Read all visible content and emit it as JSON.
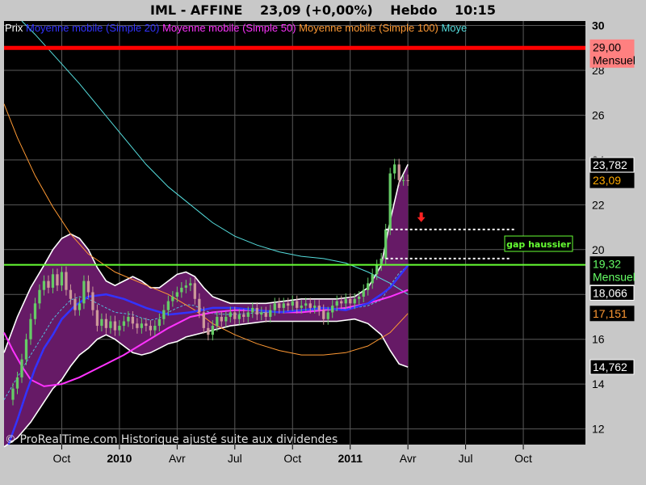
{
  "title": {
    "symbol": "IML - AFFINE",
    "price": "23,09 (+0,00%)",
    "period": "Hebdo",
    "time": "10:15"
  },
  "legend": [
    {
      "label": "Prix",
      "color": "#ffffff"
    },
    {
      "label": "Moyenne mobile (Simple 20)",
      "color": "#3333ff"
    },
    {
      "label": "Moyenne mobile (Simple 50)",
      "color": "#ff33ff"
    },
    {
      "label": "Moyenne mobile (Simple 100)",
      "color": "#ff9933"
    },
    {
      "label": "Moye",
      "color": "#55dddd"
    }
  ],
  "watermark": "© ProRealTime.com Historique ajusté suite aux dividendes",
  "price_tags": [
    {
      "text": "29,00",
      "sub": "Mensuel",
      "value": 29.0,
      "bg": "#ff8080",
      "fg": "#000000"
    },
    {
      "text": "23,782",
      "value": 23.782,
      "bg": "#000000",
      "fg": "#ffffff"
    },
    {
      "text": "23,09",
      "value": 23.09,
      "bg": "#000000",
      "fg": "#ffaa00"
    },
    {
      "text": "19,32",
      "sub": "Mensuel",
      "value": 19.32,
      "bg": "#000000",
      "fg": "#66ff66"
    },
    {
      "text": "18,066",
      "value": 18.066,
      "bg": "#000000",
      "fg": "#ffffff"
    },
    {
      "text": "17,151",
      "value": 17.151,
      "bg": "#000000",
      "fg": "#ff9933"
    },
    {
      "text": "14,762",
      "value": 14.762,
      "bg": "#000000",
      "fg": "#ffffff"
    }
  ],
  "chart_data": {
    "type": "candlestick",
    "y_ticks": [
      12,
      14,
      16,
      18,
      20,
      22,
      24,
      26,
      28,
      30
    ],
    "y_tick_labels": [
      "12",
      "14",
      "16",
      "18",
      "20",
      "22",
      "24",
      "26",
      "28",
      "30"
    ],
    "ylim": [
      11.3,
      30.2
    ],
    "x_ticks": [
      {
        "label": "Oct",
        "week": 6,
        "bold": false
      },
      {
        "label": "2010",
        "week": 19,
        "bold": true
      },
      {
        "label": "Avr",
        "week": 32,
        "bold": false
      },
      {
        "label": "Jul",
        "week": 45,
        "bold": false
      },
      {
        "label": "Oct",
        "week": 58,
        "bold": false
      },
      {
        "label": "2011",
        "week": 71,
        "bold": true
      },
      {
        "label": "Avr",
        "week": 84,
        "bold": false
      },
      {
        "label": "Jul",
        "week": 97,
        "bold": false
      },
      {
        "label": "Oct",
        "week": 110,
        "bold": false
      }
    ],
    "x_range_weeks": [
      -7,
      124
    ],
    "last_week": 84,
    "horizontal_lines": [
      {
        "value": 29.0,
        "color": "#ff0000",
        "label": "Mensuel"
      },
      {
        "value": 19.32,
        "color": "#66ff33",
        "label": "Mensuel"
      }
    ],
    "gap": {
      "upper": 20.9,
      "lower": 19.6,
      "from_week": 79,
      "to_week": 108,
      "label": "gap haussier",
      "arrow_week": 87,
      "arrow_value": 21.3
    },
    "closes_by_week": [
      [
        -6,
        13.3
      ],
      [
        -5,
        13.8
      ],
      [
        -4,
        14.3
      ],
      [
        -3,
        15.1
      ],
      [
        -2,
        16.0
      ],
      [
        -1,
        16.9
      ],
      [
        0,
        17.6
      ],
      [
        1,
        18.2
      ],
      [
        2,
        18.6
      ],
      [
        3,
        18.3
      ],
      [
        4,
        18.9
      ],
      [
        5,
        18.4
      ],
      [
        6,
        19.0
      ],
      [
        7,
        18.2
      ],
      [
        8,
        17.8
      ],
      [
        9,
        17.3
      ],
      [
        10,
        17.6
      ],
      [
        11,
        18.6
      ],
      [
        12,
        18.1
      ],
      [
        13,
        17.3
      ],
      [
        14,
        16.6
      ],
      [
        15,
        16.9
      ],
      [
        16,
        16.5
      ],
      [
        17,
        16.8
      ],
      [
        18,
        16.4
      ],
      [
        19,
        16.6
      ],
      [
        20,
        16.8
      ],
      [
        21,
        17.0
      ],
      [
        22,
        16.7
      ],
      [
        23,
        16.5
      ],
      [
        24,
        16.7
      ],
      [
        25,
        16.6
      ],
      [
        26,
        16.4
      ],
      [
        27,
        16.6
      ],
      [
        28,
        16.9
      ],
      [
        29,
        17.3
      ],
      [
        30,
        17.7
      ],
      [
        31,
        17.9
      ],
      [
        32,
        18.1
      ],
      [
        33,
        18.3
      ],
      [
        34,
        18.4
      ],
      [
        35,
        18.5
      ],
      [
        36,
        17.8
      ],
      [
        37,
        17.2
      ],
      [
        38,
        16.5
      ],
      [
        39,
        16.2
      ],
      [
        40,
        16.6
      ],
      [
        41,
        17.0
      ],
      [
        42,
        16.8
      ],
      [
        43,
        17.0
      ],
      [
        44,
        17.2
      ],
      [
        45,
        16.9
      ],
      [
        46,
        17.1
      ],
      [
        47,
        17.0
      ],
      [
        48,
        17.2
      ],
      [
        49,
        17.4
      ],
      [
        50,
        17.1
      ],
      [
        51,
        17.2
      ],
      [
        52,
        17.0
      ],
      [
        53,
        17.3
      ],
      [
        54,
        17.6
      ],
      [
        55,
        17.4
      ],
      [
        56,
        17.6
      ],
      [
        57,
        17.5
      ],
      [
        58,
        17.7
      ],
      [
        59,
        17.4
      ],
      [
        60,
        17.5
      ],
      [
        61,
        17.6
      ],
      [
        62,
        17.4
      ],
      [
        63,
        17.5
      ],
      [
        64,
        17.3
      ],
      [
        65,
        16.9
      ],
      [
        66,
        17.2
      ],
      [
        67,
        17.5
      ],
      [
        68,
        17.7
      ],
      [
        69,
        17.6
      ],
      [
        70,
        17.8
      ],
      [
        71,
        17.6
      ],
      [
        72,
        17.8
      ],
      [
        73,
        17.9
      ],
      [
        74,
        18.2
      ],
      [
        75,
        18.5
      ],
      [
        76,
        18.9
      ],
      [
        77,
        19.3
      ],
      [
        78,
        19.6
      ],
      [
        79,
        20.9
      ],
      [
        80,
        23.4
      ],
      [
        81,
        23.8
      ],
      [
        82,
        23.1
      ],
      [
        83,
        23.1
      ],
      [
        84,
        23.09
      ]
    ],
    "sma20": [
      [
        -6,
        11.3
      ],
      [
        -4,
        12.4
      ],
      [
        -2,
        13.6
      ],
      [
        0,
        14.7
      ],
      [
        2,
        15.6
      ],
      [
        4,
        16.2
      ],
      [
        6,
        16.9
      ],
      [
        9,
        17.5
      ],
      [
        12,
        17.9
      ],
      [
        16,
        18.0
      ],
      [
        20,
        17.8
      ],
      [
        25,
        17.4
      ],
      [
        30,
        17.1
      ],
      [
        35,
        17.2
      ],
      [
        40,
        17.4
      ],
      [
        45,
        17.4
      ],
      [
        50,
        17.3
      ],
      [
        55,
        17.2
      ],
      [
        60,
        17.3
      ],
      [
        65,
        17.4
      ],
      [
        70,
        17.3
      ],
      [
        75,
        17.6
      ],
      [
        78,
        18.0
      ],
      [
        80,
        18.3
      ],
      [
        82,
        18.8
      ],
      [
        84,
        19.3
      ]
    ],
    "sma50": [
      [
        -7,
        16.3
      ],
      [
        -5,
        15.5
      ],
      [
        -3,
        14.8
      ],
      [
        -1,
        14.2
      ],
      [
        2,
        13.9
      ],
      [
        6,
        14.0
      ],
      [
        10,
        14.3
      ],
      [
        15,
        14.8
      ],
      [
        20,
        15.3
      ],
      [
        25,
        15.9
      ],
      [
        30,
        16.5
      ],
      [
        35,
        17.0
      ],
      [
        40,
        17.2
      ],
      [
        45,
        17.3
      ],
      [
        50,
        17.3
      ],
      [
        55,
        17.2
      ],
      [
        60,
        17.2
      ],
      [
        65,
        17.3
      ],
      [
        70,
        17.4
      ],
      [
        75,
        17.6
      ],
      [
        80,
        17.9
      ],
      [
        84,
        18.2
      ]
    ],
    "sma100": [
      [
        -7,
        26.5
      ],
      [
        -4,
        25.0
      ],
      [
        0,
        23.3
      ],
      [
        4,
        21.9
      ],
      [
        8,
        20.7
      ],
      [
        12,
        19.8
      ],
      [
        18,
        19.0
      ],
      [
        24,
        18.5
      ],
      [
        30,
        18.0
      ],
      [
        36,
        17.3
      ],
      [
        40,
        16.7
      ],
      [
        45,
        16.2
      ],
      [
        50,
        15.8
      ],
      [
        55,
        15.5
      ],
      [
        60,
        15.3
      ],
      [
        65,
        15.3
      ],
      [
        70,
        15.4
      ],
      [
        75,
        15.7
      ],
      [
        80,
        16.3
      ],
      [
        84,
        17.15
      ]
    ],
    "sma200": [
      [
        -3,
        30.2
      ],
      [
        0,
        29.6
      ],
      [
        5,
        28.5
      ],
      [
        10,
        27.4
      ],
      [
        15,
        26.2
      ],
      [
        20,
        25.0
      ],
      [
        25,
        23.8
      ],
      [
        30,
        22.8
      ],
      [
        35,
        22.0
      ],
      [
        40,
        21.2
      ],
      [
        45,
        20.6
      ],
      [
        50,
        20.2
      ],
      [
        55,
        19.9
      ],
      [
        60,
        19.7
      ],
      [
        65,
        19.6
      ],
      [
        70,
        19.4
      ],
      [
        75,
        19.0
      ],
      [
        80,
        18.5
      ],
      [
        84,
        18.0
      ]
    ],
    "bollinger_upper": [
      [
        -7,
        15.4
      ],
      [
        -4,
        17.0
      ],
      [
        -1,
        18.3
      ],
      [
        2,
        19.3
      ],
      [
        4,
        20.0
      ],
      [
        6,
        20.5
      ],
      [
        8,
        20.7
      ],
      [
        10,
        20.5
      ],
      [
        12,
        20.0
      ],
      [
        14,
        19.2
      ],
      [
        16,
        18.6
      ],
      [
        18,
        18.4
      ],
      [
        20,
        18.6
      ],
      [
        22,
        18.8
      ],
      [
        24,
        18.6
      ],
      [
        26,
        18.3
      ],
      [
        28,
        18.3
      ],
      [
        30,
        18.6
      ],
      [
        32,
        18.9
      ],
      [
        34,
        19.0
      ],
      [
        36,
        18.8
      ],
      [
        38,
        18.3
      ],
      [
        40,
        17.9
      ],
      [
        44,
        17.6
      ],
      [
        48,
        17.6
      ],
      [
        52,
        17.6
      ],
      [
        56,
        17.7
      ],
      [
        60,
        17.8
      ],
      [
        64,
        17.8
      ],
      [
        68,
        17.8
      ],
      [
        72,
        17.9
      ],
      [
        75,
        18.3
      ],
      [
        78,
        19.3
      ],
      [
        80,
        21.3
      ],
      [
        82,
        23.0
      ],
      [
        84,
        23.8
      ]
    ],
    "bollinger_lower": [
      [
        -7,
        11.2
      ],
      [
        -4,
        11.6
      ],
      [
        -1,
        12.3
      ],
      [
        2,
        13.2
      ],
      [
        4,
        13.8
      ],
      [
        6,
        14.2
      ],
      [
        8,
        14.8
      ],
      [
        10,
        15.3
      ],
      [
        12,
        15.6
      ],
      [
        14,
        16.0
      ],
      [
        16,
        16.2
      ],
      [
        18,
        16.0
      ],
      [
        20,
        15.7
      ],
      [
        22,
        15.4
      ],
      [
        24,
        15.3
      ],
      [
        26,
        15.4
      ],
      [
        28,
        15.6
      ],
      [
        30,
        15.8
      ],
      [
        32,
        15.9
      ],
      [
        34,
        16.1
      ],
      [
        36,
        16.2
      ],
      [
        38,
        16.3
      ],
      [
        40,
        16.4
      ],
      [
        44,
        16.6
      ],
      [
        48,
        16.7
      ],
      [
        52,
        16.8
      ],
      [
        56,
        16.8
      ],
      [
        60,
        16.8
      ],
      [
        64,
        16.8
      ],
      [
        68,
        16.8
      ],
      [
        72,
        16.9
      ],
      [
        75,
        16.7
      ],
      [
        78,
        16.2
      ],
      [
        80,
        15.5
      ],
      [
        82,
        14.9
      ],
      [
        84,
        14.76
      ]
    ]
  },
  "colors": {
    "plot_bg": "#000000",
    "grid": "#5a5a5a",
    "bollinger_fill": "#661a66",
    "bollinger_line": "#ffffff",
    "candle_up": "#66cc66",
    "candle_down": "#cc9999",
    "sma20": "#3333ff",
    "sma50": "#ff33ff",
    "sma100": "#ff9933",
    "sma200": "#55dddd",
    "axis_text": "#000000",
    "arrow": "#ff2222",
    "gap_label": "#66ff33"
  }
}
